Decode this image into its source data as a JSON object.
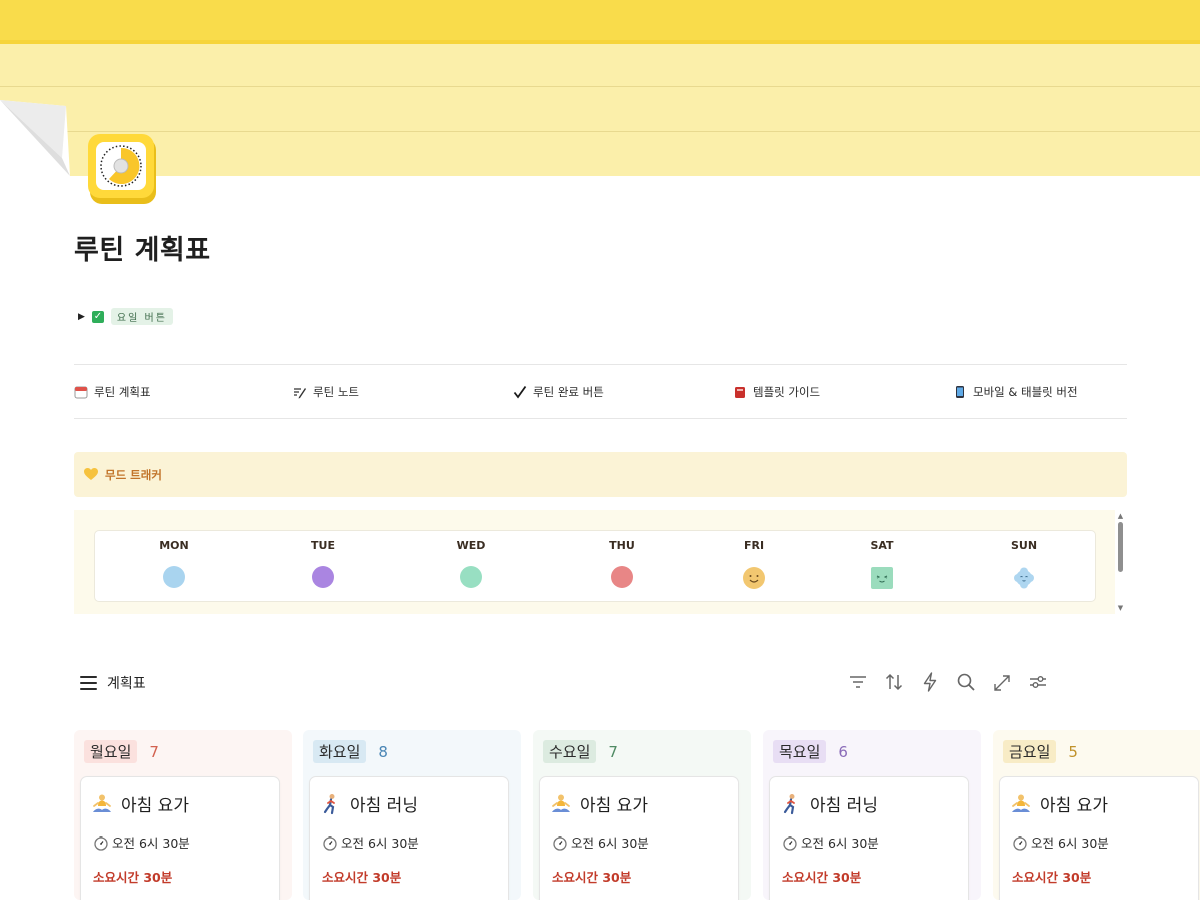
{
  "page": {
    "title": "루틴 계획표"
  },
  "toggle": {
    "tag_label": "요일 버튼"
  },
  "nav": [
    {
      "label": "루틴 계획표",
      "icon": "calendar-icon"
    },
    {
      "label": "루틴 노트",
      "icon": "pen-icon"
    },
    {
      "label": "루틴 완료 버튼",
      "icon": "checkmark-icon"
    },
    {
      "label": "템플릿 가이드",
      "icon": "book-icon"
    },
    {
      "label": "모바일 & 태블릿 버전",
      "icon": "phone-icon"
    }
  ],
  "mood_callout": {
    "label": "무드 트래커",
    "icon": "yellow-heart-icon"
  },
  "mood_tracker": {
    "days": [
      {
        "label": "MON",
        "color": "#a9d4ef",
        "kind": "dot"
      },
      {
        "label": "TUE",
        "color": "#aa85e1",
        "kind": "dot"
      },
      {
        "label": "WED",
        "color": "#98dfc2",
        "kind": "dot"
      },
      {
        "label": "THU",
        "color": "#e88686",
        "kind": "dot"
      },
      {
        "label": "FRI",
        "color": "#f2c770",
        "kind": "smile"
      },
      {
        "label": "SAT",
        "color": "#9bdcbd",
        "kind": "square"
      },
      {
        "label": "SUN",
        "color": "#aed6f0",
        "kind": "cloud"
      }
    ]
  },
  "board": {
    "title": "계획표"
  },
  "columns": [
    {
      "tag": "월요일",
      "count": "7",
      "tag_bg": "#fbe1de",
      "bg": "#fdf5f3",
      "count_color": "#d2614f",
      "card": {
        "emoji": "yoga-icon",
        "title": "아침 요가",
        "time": "오전 6시 30분",
        "duration": "소요시간 30분"
      }
    },
    {
      "tag": "화요일",
      "count": "8",
      "tag_bg": "#d8e9f3",
      "bg": "#f3f8fb",
      "count_color": "#4a86b5",
      "card": {
        "emoji": "running-icon",
        "title": "아침 러닝",
        "time": "오전 6시 30분",
        "duration": "소요시간 30분"
      }
    },
    {
      "tag": "수요일",
      "count": "7",
      "tag_bg": "#dcebe0",
      "bg": "#f4f9f5",
      "count_color": "#4f8a63",
      "card": {
        "emoji": "yoga-icon",
        "title": "아침 요가",
        "time": "오전 6시 30분",
        "duration": "소요시간 30분"
      }
    },
    {
      "tag": "목요일",
      "count": "6",
      "tag_bg": "#e8def4",
      "bg": "#f8f5fb",
      "count_color": "#8a6bb8",
      "card": {
        "emoji": "running-icon",
        "title": "아침 러닝",
        "time": "오전 6시 30분",
        "duration": "소요시간 30분"
      }
    },
    {
      "tag": "금요일",
      "count": "5",
      "tag_bg": "#f8ecc6",
      "bg": "#fdfaef",
      "count_color": "#c0922c",
      "card": {
        "emoji": "yoga-icon",
        "title": "아침 요가",
        "time": "오전 6시 30분",
        "duration": "소요시간 30분"
      }
    }
  ]
}
